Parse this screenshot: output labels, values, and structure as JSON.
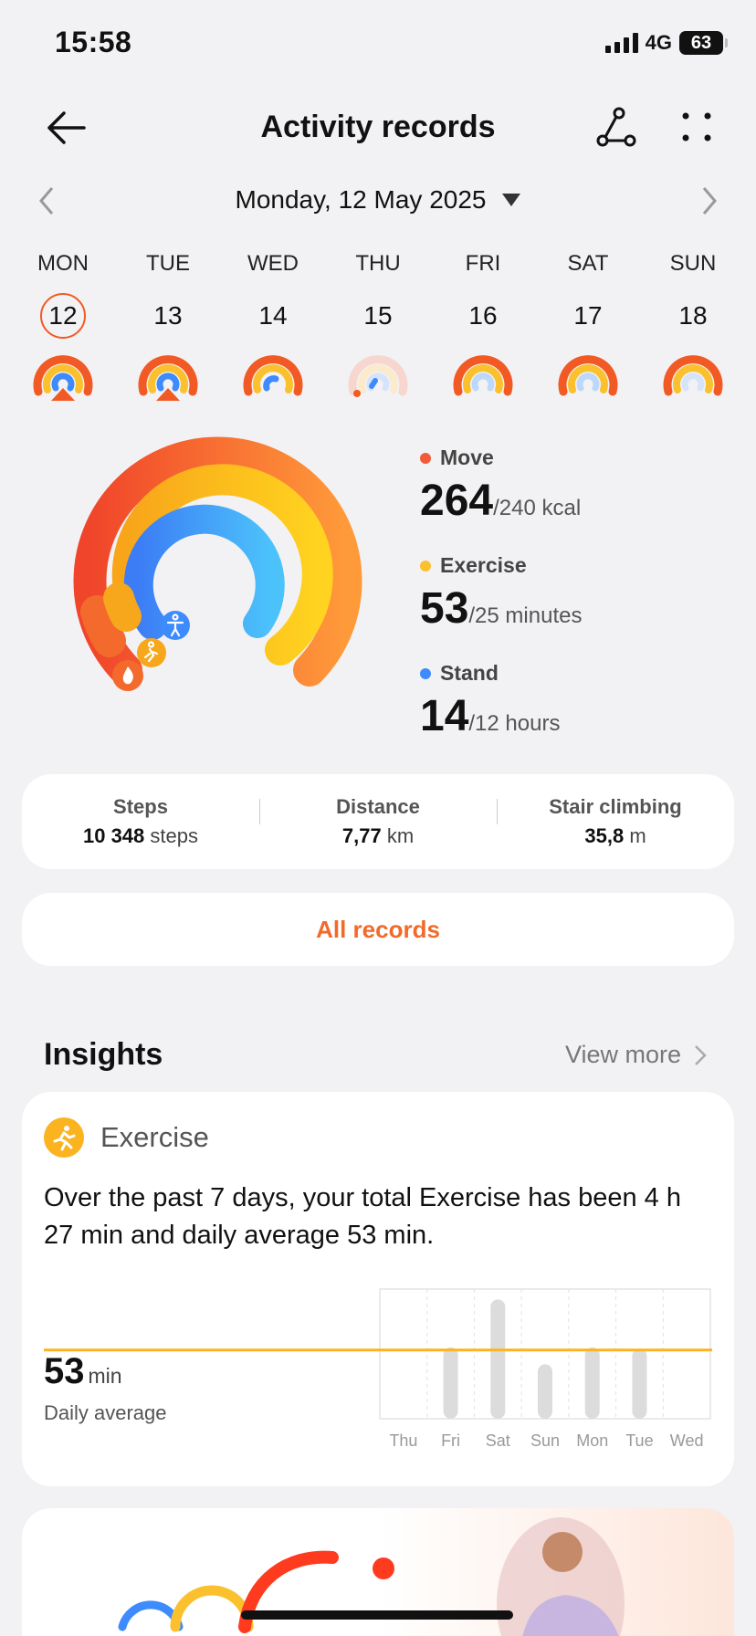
{
  "status": {
    "time": "15:58",
    "network": "4G",
    "battery": "63"
  },
  "header": {
    "title": "Activity records"
  },
  "date_selector": {
    "label": "Monday, 12 May 2025"
  },
  "week": [
    {
      "name": "MON",
      "num": "12",
      "selected": true
    },
    {
      "name": "TUE",
      "num": "13"
    },
    {
      "name": "WED",
      "num": "14"
    },
    {
      "name": "THU",
      "num": "15"
    },
    {
      "name": "FRI",
      "num": "16"
    },
    {
      "name": "SAT",
      "num": "17"
    },
    {
      "name": "SUN",
      "num": "18"
    }
  ],
  "rings": {
    "move": {
      "label": "Move",
      "value": "264",
      "goal": "/240 kcal",
      "color": "#f15a3a"
    },
    "exercise": {
      "label": "Exercise",
      "value": "53",
      "goal": "/25 minutes",
      "color": "#fbc02d"
    },
    "stand": {
      "label": "Stand",
      "value": "14",
      "goal": "/12 hours",
      "color": "#3d8bfd"
    }
  },
  "summary": {
    "steps": {
      "label": "Steps",
      "value": "10 348",
      "unit": "steps"
    },
    "distance": {
      "label": "Distance",
      "value": "7,77",
      "unit": "km"
    },
    "stairs": {
      "label": "Stair climbing",
      "value": "35,8",
      "unit": "m"
    }
  },
  "all_records": "All records",
  "insights": {
    "title": "Insights",
    "view_more": "View more",
    "card": {
      "label": "Exercise",
      "text": "Over the past 7 days, your total Exercise has been 4 h 27 min and daily average 53 min.",
      "avg_value": "53",
      "avg_unit": "min",
      "avg_label": "Daily average"
    }
  },
  "chart_data": {
    "type": "bar",
    "categories": [
      "Thu",
      "Fri",
      "Sat",
      "Sun",
      "Mon",
      "Tue",
      "Wed"
    ],
    "values": [
      0,
      55,
      92,
      42,
      55,
      54,
      0
    ],
    "reference_line": 53,
    "ylim": [
      0,
      100
    ],
    "title": "",
    "xlabel": "",
    "ylabel": ""
  }
}
